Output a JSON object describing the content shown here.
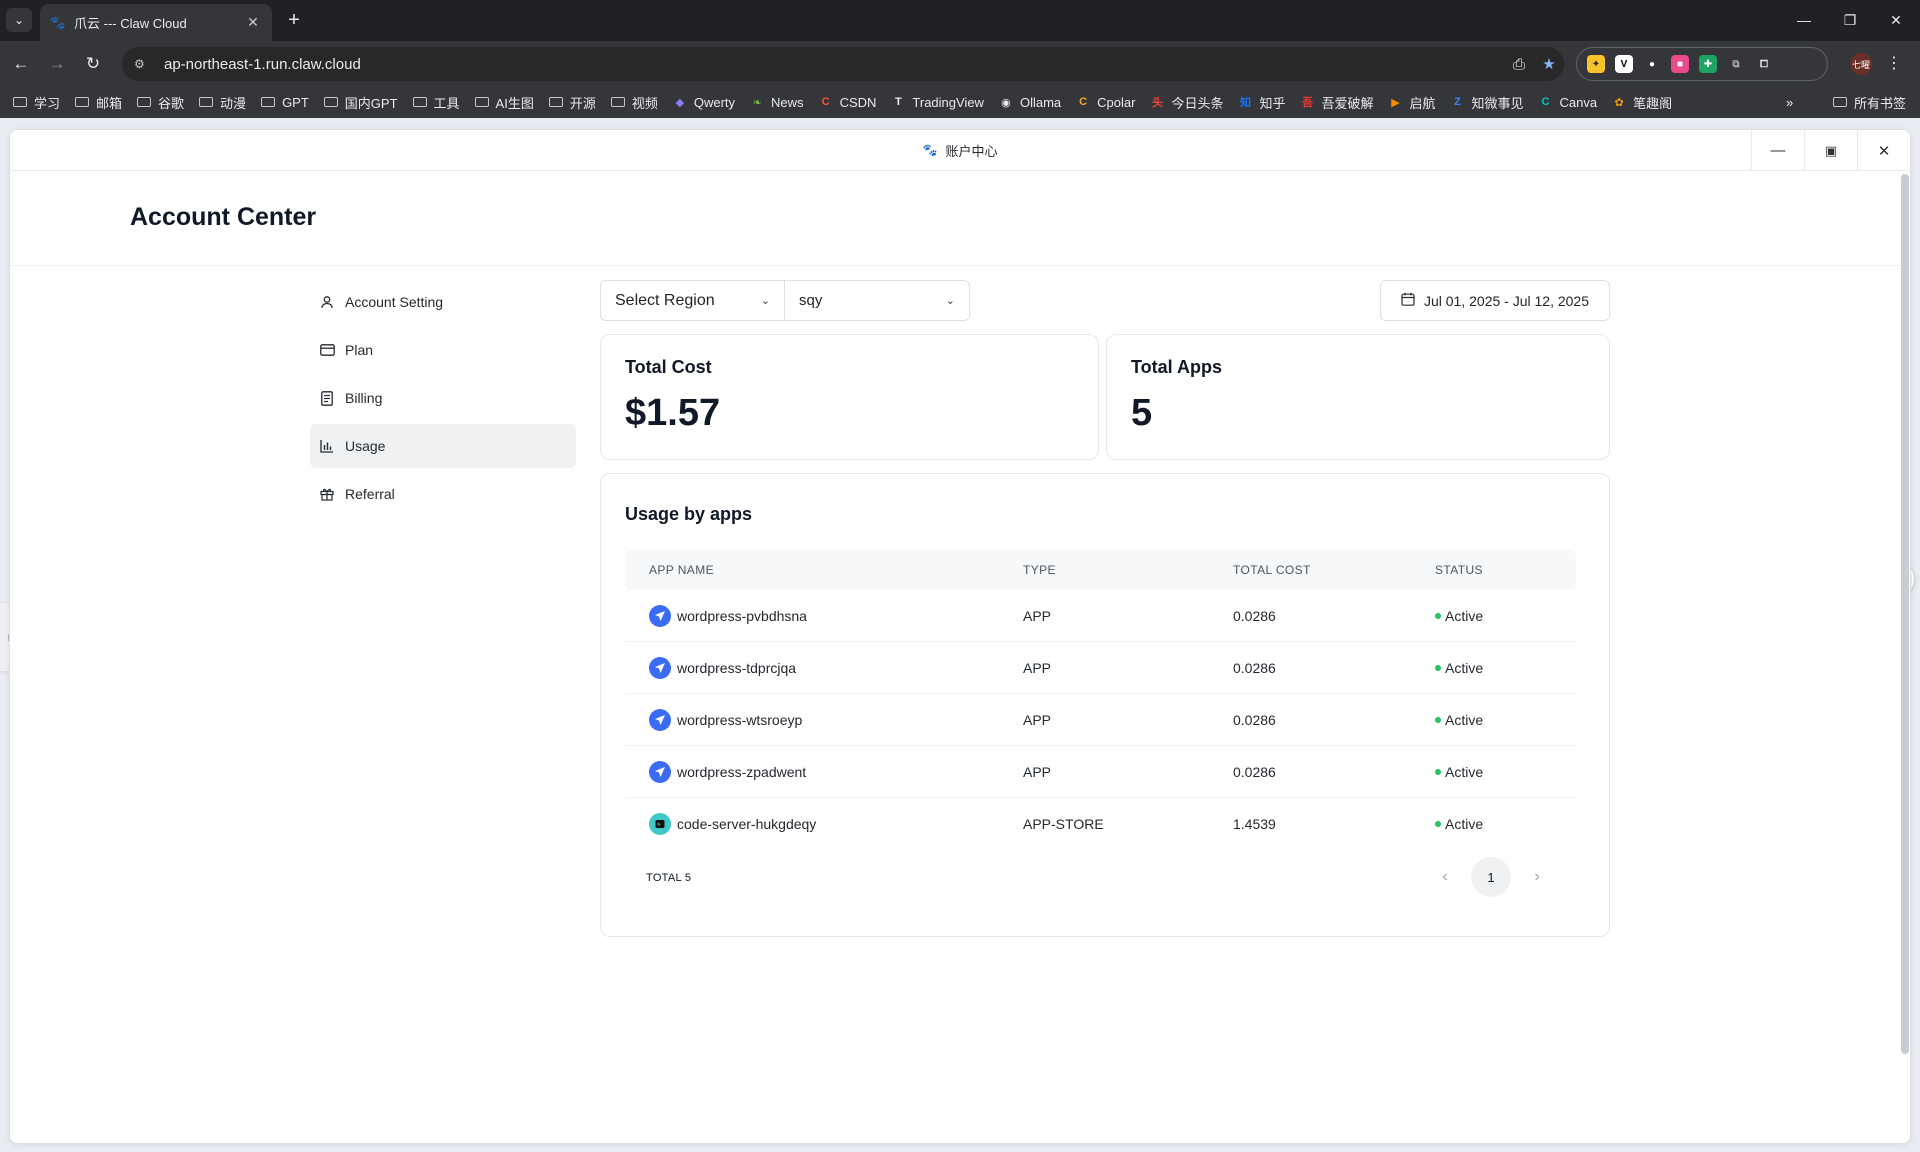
{
  "browser": {
    "tab_title": "爪云 --- Claw Cloud",
    "url": "ap-northeast-1.run.claw.cloud",
    "profile_label": "七曜",
    "bookmarks": [
      {
        "label": "学习",
        "icon": "folder-icon"
      },
      {
        "label": "邮箱",
        "icon": "folder-icon"
      },
      {
        "label": "谷歌",
        "icon": "folder-icon"
      },
      {
        "label": "动漫",
        "icon": "folder-icon"
      },
      {
        "label": "GPT",
        "icon": "folder-icon"
      },
      {
        "label": "国内GPT",
        "icon": "folder-icon"
      },
      {
        "label": "工具",
        "icon": "folder-icon"
      },
      {
        "label": "AI生图",
        "icon": "folder-icon"
      },
      {
        "label": "开源",
        "icon": "folder-icon"
      },
      {
        "label": "视频",
        "icon": "folder-icon"
      },
      {
        "label": "Qwerty",
        "icon": "qwerty-icon"
      },
      {
        "label": "News",
        "icon": "news-icon"
      },
      {
        "label": "CSDN",
        "icon": "csdn-icon"
      },
      {
        "label": "TradingView",
        "icon": "tradingview-icon"
      },
      {
        "label": "Ollama",
        "icon": "ollama-icon"
      },
      {
        "label": "Cpolar",
        "icon": "cpolar-icon"
      },
      {
        "label": "今日头条",
        "icon": "toutiao-icon"
      },
      {
        "label": "知乎",
        "icon": "zhihu-icon"
      },
      {
        "label": "吾爱破解",
        "icon": "52pojie-icon"
      },
      {
        "label": "启航",
        "icon": "qihang-icon"
      },
      {
        "label": "知微事见",
        "icon": "zhiwei-icon"
      },
      {
        "label": "Canva",
        "icon": "canva-icon"
      },
      {
        "label": "笔趣阁",
        "icon": "biquge-icon"
      }
    ],
    "more_bookmarks": "»",
    "all_bookmarks": "所有书签"
  },
  "window": {
    "title": "账户中心"
  },
  "page": {
    "title": "Account Center"
  },
  "sidebar": {
    "items": [
      {
        "label": "Account Setting",
        "icon": "user-icon",
        "active": false
      },
      {
        "label": "Plan",
        "icon": "card-icon",
        "active": false
      },
      {
        "label": "Billing",
        "icon": "receipt-icon",
        "active": false
      },
      {
        "label": "Usage",
        "icon": "bar-chart-icon",
        "active": true
      },
      {
        "label": "Referral",
        "icon": "gift-icon",
        "active": false
      }
    ]
  },
  "filters": {
    "region_value": "Select Region",
    "workspace_value": "sqy",
    "date_range": "Jul 01, 2025 - Jul 12, 2025"
  },
  "stats": {
    "total_cost_label": "Total Cost",
    "total_cost_value": "$1.57",
    "total_apps_label": "Total Apps",
    "total_apps_value": "5"
  },
  "usage": {
    "title": "Usage by apps",
    "columns": [
      "APP NAME",
      "TYPE",
      "TOTAL COST",
      "STATUS"
    ],
    "rows": [
      {
        "name": "wordpress-pvbdhsna",
        "type": "APP",
        "cost": "0.0286",
        "status": "Active",
        "icon": "rocket-icon"
      },
      {
        "name": "wordpress-tdprcjqa",
        "type": "APP",
        "cost": "0.0286",
        "status": "Active",
        "icon": "rocket-icon"
      },
      {
        "name": "wordpress-wtsroeyp",
        "type": "APP",
        "cost": "0.0286",
        "status": "Active",
        "icon": "rocket-icon"
      },
      {
        "name": "wordpress-zpadwent",
        "type": "APP",
        "cost": "0.0286",
        "status": "Active",
        "icon": "rocket-icon"
      },
      {
        "name": "code-server-hukgdeqy",
        "type": "APP-STORE",
        "cost": "1.4539",
        "status": "Active",
        "icon": "code-server-icon"
      }
    ],
    "total_label": "TOTAL 5",
    "current_page": "1"
  },
  "colors": {
    "active_status": "#22c55e",
    "rocket_bg": "#3b6cf6",
    "code_server_bg": "#3fc8c8"
  }
}
